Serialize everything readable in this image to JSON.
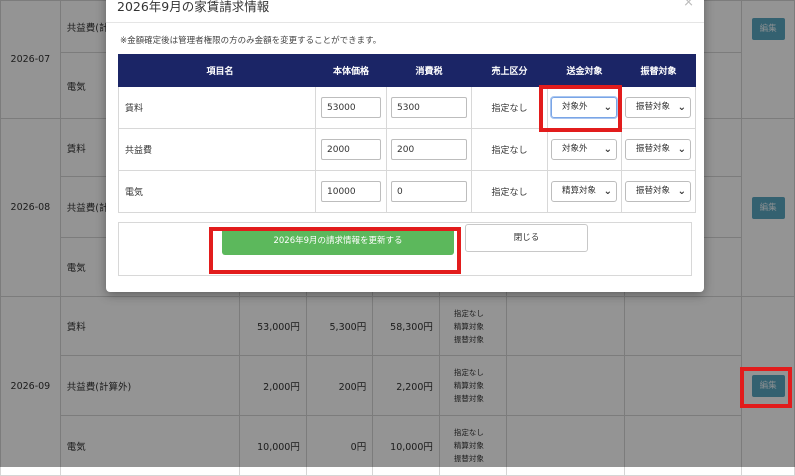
{
  "background": {
    "rows": [
      {
        "month": "2026-07",
        "item": "共益費(計",
        "price": "",
        "tax": "",
        "total": "",
        "flags": [],
        "month_visible": true,
        "edit": true
      },
      {
        "month": "",
        "item": "電気",
        "price": "",
        "tax": "",
        "total": "",
        "flags": []
      },
      {
        "month": "",
        "item": "賃料",
        "price": "",
        "tax": "",
        "total": "",
        "flags": []
      },
      {
        "month": "2026-08",
        "item": "共益費(計",
        "price": "",
        "tax": "",
        "total": "",
        "flags": [],
        "edit": true
      },
      {
        "month": "",
        "item": "電気",
        "price": "",
        "tax": "",
        "total": "",
        "flags": []
      },
      {
        "month": "",
        "item": "賃料",
        "price": "53,000円",
        "tax": "5,300円",
        "total": "58,300円",
        "flags": [
          "指定なし",
          "精算対象",
          "振替対象"
        ]
      },
      {
        "month": "2026-09",
        "item": "共益費(計算外)",
        "price": "2,000円",
        "tax": "200円",
        "total": "2,200円",
        "flags": [
          "指定なし",
          "精算対象",
          "振替対象"
        ],
        "edit": true
      },
      {
        "month": "",
        "item": "電気",
        "price": "10,000円",
        "tax": "0円",
        "total": "10,000円",
        "flags": [
          "指定なし",
          "精算対象",
          "振替対象"
        ]
      }
    ],
    "edit_label": "編集"
  },
  "modal": {
    "title": "2026年9月の家賃請求情報",
    "close_glyph": "×",
    "note": "※金額確定後は管理者権限の方のみ金額を変更することができます。",
    "headers": [
      "項目名",
      "本体価格",
      "消費税",
      "売上区分",
      "送金対象",
      "振替対象"
    ],
    "rows": [
      {
        "name": "賃料",
        "price": "53000",
        "tax": "5300",
        "sale": "指定なし",
        "send": "対象外",
        "transfer": "振替対象"
      },
      {
        "name": "共益費",
        "price": "2000",
        "tax": "200",
        "sale": "指定なし",
        "send": "対象外",
        "transfer": "振替対象"
      },
      {
        "name": "電気",
        "price": "10000",
        "tax": "0",
        "sale": "指定なし",
        "send": "精算対象",
        "transfer": "振替対象"
      }
    ],
    "update_label": "2026年9月の請求情報を更新する",
    "close_label": "閉じる"
  },
  "colors": {
    "header_navy": "#1b2566",
    "update_green": "#5cb85c",
    "highlight_red": "#e21c1c",
    "edit_blue": "#5aa7c2"
  }
}
